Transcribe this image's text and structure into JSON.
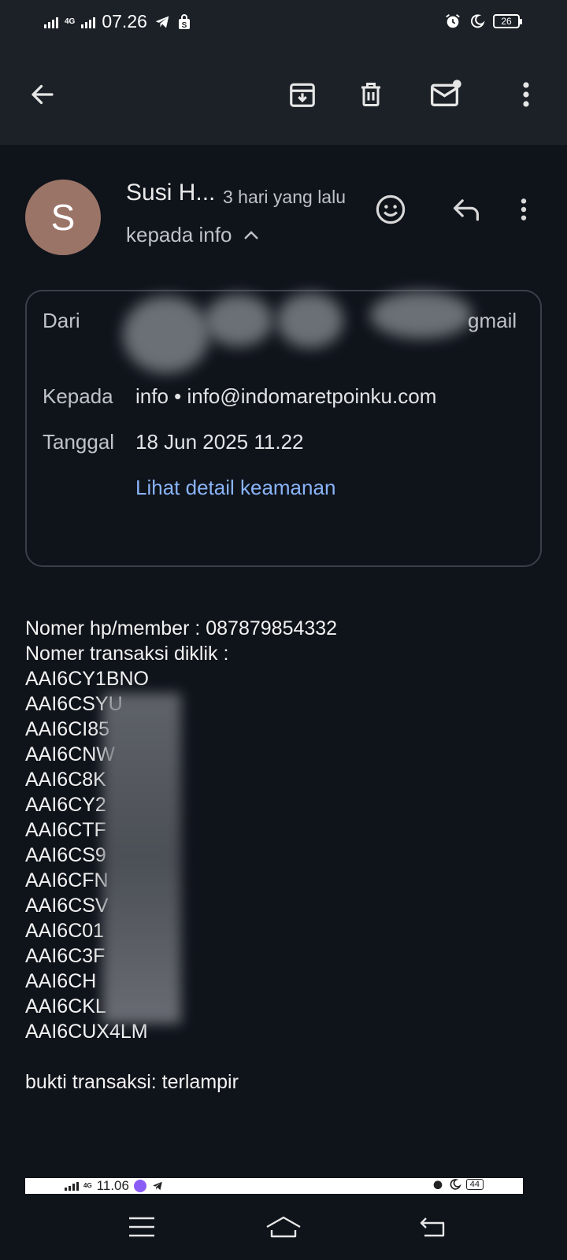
{
  "status_bar": {
    "network": "4G",
    "time": "07.26",
    "battery": "26"
  },
  "toolbar": {
    "back_icon": "arrow-left-icon",
    "archive_icon": "archive-icon",
    "delete_icon": "trash-icon",
    "unread_icon": "mail-unread-icon",
    "more_icon": "more-vert-icon"
  },
  "message": {
    "avatar_letter": "S",
    "sender": "Susi H...",
    "time": "3 hari yang lalu",
    "recipient": "kepada info"
  },
  "details": {
    "from_label": "Dari",
    "from_value_suffix": "gmail",
    "to_label": "Kepada",
    "to_value": "info • info@indomaretpoinku.com",
    "date_label": "Tanggal",
    "date_value": "18 Jun 2025 11.22",
    "security_link": "Lihat detail keamanan"
  },
  "body": {
    "line1": "Nomer hp/member : 087879854332",
    "line2": "Nomer transaksi diklik :",
    "codes": [
      "AAI6CY1BNO",
      "AAI6CSYU",
      "AAI6CI85",
      "AAI6CNW",
      "AAI6C8K",
      "AAI6CY2",
      "AAI6CTF",
      "AAI6CS9",
      "AAI6CFN",
      "AAI6CSV",
      "AAI6C01",
      "AAI6C3F",
      "AAI6CH",
      "AAI6CKL",
      "AAI6CUX4LM"
    ],
    "footer": "bukti transaksi: terlampir"
  },
  "attachment_status": {
    "network": "4G",
    "time": "11.06",
    "battery": "44"
  },
  "nav": {
    "menu_icon": "menu-icon",
    "home_icon": "home-icon",
    "back_icon": "back-icon"
  }
}
